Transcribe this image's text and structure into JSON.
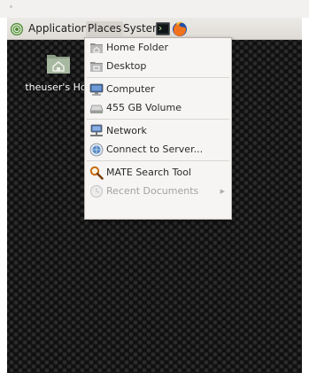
{
  "panel": {
    "applications_label": "Applications",
    "places_label": "Places",
    "system_label": "System"
  },
  "desktop": {
    "home_icon_label": "theuser's Ho"
  },
  "places_menu": {
    "items": [
      {
        "label": "Home Folder",
        "icon": "home-folder-icon"
      },
      {
        "label": "Desktop",
        "icon": "desktop-folder-icon"
      },
      {
        "label": "Computer",
        "icon": "computer-icon"
      },
      {
        "label": "455 GB Volume",
        "icon": "drive-icon"
      },
      {
        "label": "Network",
        "icon": "network-icon"
      },
      {
        "label": "Connect to Server...",
        "icon": "server-icon"
      },
      {
        "label": "MATE Search Tool",
        "icon": "search-icon"
      },
      {
        "label": "Recent Documents",
        "icon": "clock-icon",
        "disabled": true,
        "submenu": true
      }
    ]
  },
  "colors": {
    "panel": "#e6e3df",
    "menu": "#f6f5f4",
    "desktop": "#0d0d0d",
    "folder": "#a7b8a0"
  }
}
